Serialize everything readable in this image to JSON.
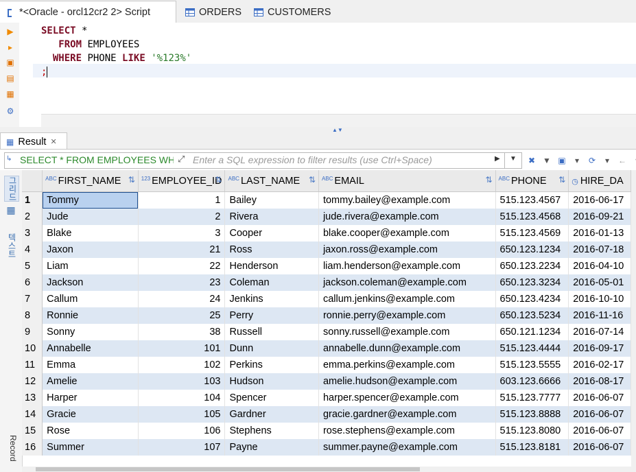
{
  "tabs": [
    {
      "label": "*<Oracle - orcl12cr2 2> Script",
      "active": true
    },
    {
      "label": "ORDERS",
      "active": false
    },
    {
      "label": "CUSTOMERS",
      "active": false
    }
  ],
  "editor": {
    "line1_kw": "SELECT",
    "line1_rest": " *",
    "line2_kw": "FROM",
    "line2_rest": " EMPLOYEES",
    "line3_kw": "WHERE",
    "line3_mid": " PHONE ",
    "line3_kw2": "LIKE",
    "line3_str": "'%123%'",
    "line4": ";"
  },
  "result_tab": {
    "label": "Result",
    "close": "✕"
  },
  "filter": {
    "query": "SELECT * FROM EMPLOYEES WH",
    "placeholder": "Enter a SQL expression to filter results (use Ctrl+Space)"
  },
  "side_tabs": {
    "grid": "그리드",
    "text": "텍스트",
    "record": "Record"
  },
  "columns": [
    {
      "name": "FIRST_NAME",
      "type": "ABC"
    },
    {
      "name": "EMPLOYEE_ID",
      "type": "123"
    },
    {
      "name": "LAST_NAME",
      "type": "ABC"
    },
    {
      "name": "EMAIL",
      "type": "ABC"
    },
    {
      "name": "PHONE",
      "type": "ABC"
    },
    {
      "name": "HIRE_DA",
      "type": "clock"
    }
  ],
  "rows": [
    [
      "1",
      "Tommy",
      "1",
      "Bailey",
      "tommy.bailey@example.com",
      "515.123.4567",
      "2016-06-17"
    ],
    [
      "2",
      "Jude",
      "2",
      "Rivera",
      "jude.rivera@example.com",
      "515.123.4568",
      "2016-09-21"
    ],
    [
      "3",
      "Blake",
      "3",
      "Cooper",
      "blake.cooper@example.com",
      "515.123.4569",
      "2016-01-13"
    ],
    [
      "4",
      "Jaxon",
      "21",
      "Ross",
      "jaxon.ross@example.com",
      "650.123.1234",
      "2016-07-18"
    ],
    [
      "5",
      "Liam",
      "22",
      "Henderson",
      "liam.henderson@example.com",
      "650.123.2234",
      "2016-04-10"
    ],
    [
      "6",
      "Jackson",
      "23",
      "Coleman",
      "jackson.coleman@example.com",
      "650.123.3234",
      "2016-05-01"
    ],
    [
      "7",
      "Callum",
      "24",
      "Jenkins",
      "callum.jenkins@example.com",
      "650.123.4234",
      "2016-10-10"
    ],
    [
      "8",
      "Ronnie",
      "25",
      "Perry",
      "ronnie.perry@example.com",
      "650.123.5234",
      "2016-11-16"
    ],
    [
      "9",
      "Sonny",
      "38",
      "Russell",
      "sonny.russell@example.com",
      "650.121.1234",
      "2016-07-14"
    ],
    [
      "10",
      "Annabelle",
      "101",
      "Dunn",
      "annabelle.dunn@example.com",
      "515.123.4444",
      "2016-09-17"
    ],
    [
      "11",
      "Emma",
      "102",
      "Perkins",
      "emma.perkins@example.com",
      "515.123.5555",
      "2016-02-17"
    ],
    [
      "12",
      "Amelie",
      "103",
      "Hudson",
      "amelie.hudson@example.com",
      "603.123.6666",
      "2016-08-17"
    ],
    [
      "13",
      "Harper",
      "104",
      "Spencer",
      "harper.spencer@example.com",
      "515.123.7777",
      "2016-06-07"
    ],
    [
      "14",
      "Gracie",
      "105",
      "Gardner",
      "gracie.gardner@example.com",
      "515.123.8888",
      "2016-06-07"
    ],
    [
      "15",
      "Rose",
      "106",
      "Stephens",
      "rose.stephens@example.com",
      "515.123.8080",
      "2016-06-07"
    ],
    [
      "16",
      "Summer",
      "107",
      "Payne",
      "summer.payne@example.com",
      "515.123.8181",
      "2016-06-07"
    ]
  ],
  "colors": {
    "keyword": "#7a0c24",
    "string": "#2a7a2a",
    "row_alt": "#dde7f3",
    "selection": "#b9d1ef"
  }
}
